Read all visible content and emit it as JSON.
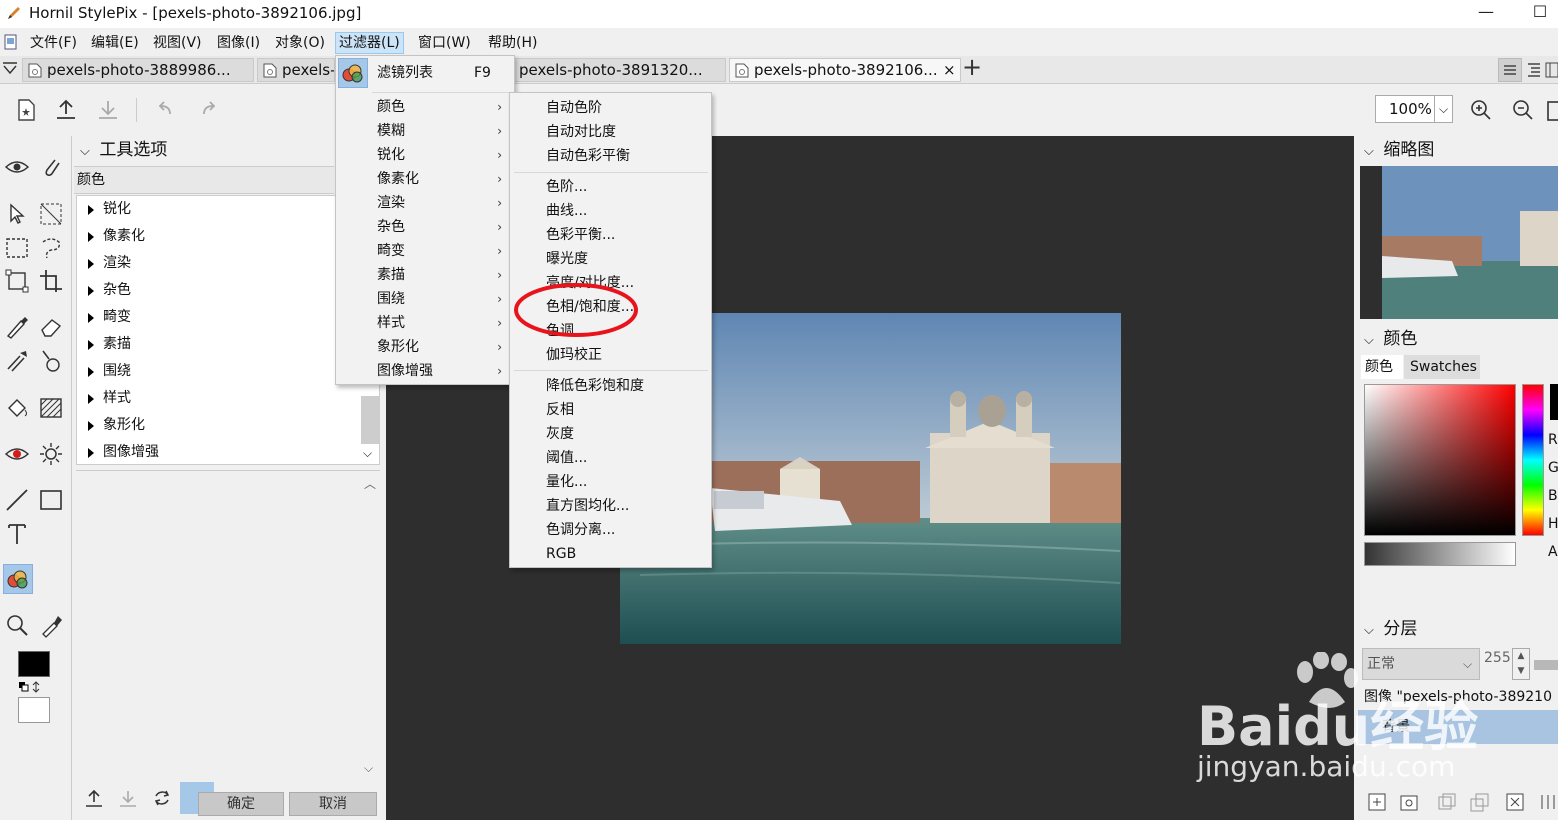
{
  "window": {
    "title": "Hornil StylePix - [pexels-photo-3892106.jpg]",
    "minimize": "—",
    "maximize": "☐"
  },
  "menubar": [
    {
      "label": "文件(F)"
    },
    {
      "label": "编辑(E)"
    },
    {
      "label": "视图(V)"
    },
    {
      "label": "图像(I)"
    },
    {
      "label": "对象(O)"
    },
    {
      "label": "过滤器(L)"
    },
    {
      "label": "窗口(W)"
    },
    {
      "label": "帮助(H)"
    }
  ],
  "tabs": [
    {
      "label": "pexels-photo-3889986..."
    },
    {
      "label": "pexels-"
    },
    {
      "label": "pexels-photo-3891320..."
    },
    {
      "label": "pexels-photo-3892106..."
    }
  ],
  "tab_close": "×",
  "tab_add": "+",
  "toolbar": {
    "zoom": "100%"
  },
  "tool_options": {
    "header": "工具选项",
    "selected": "颜色",
    "items": [
      "锐化",
      "像素化",
      "渲染",
      "杂色",
      "畸变",
      "素描",
      "围绕",
      "样式",
      "象形化",
      "图像增强"
    ],
    "ok_label": "确定",
    "cancel_label": "取消"
  },
  "filter_menu": {
    "top": {
      "label": "滤镜列表",
      "shortcut": "F9"
    },
    "items": [
      "颜色",
      "模糊",
      "锐化",
      "像素化",
      "渲染",
      "杂色",
      "畸变",
      "素描",
      "围绕",
      "样式",
      "象形化",
      "图像增强"
    ]
  },
  "color_submenu": {
    "group1": [
      "自动色阶",
      "自动对比度",
      "自动色彩平衡"
    ],
    "group2": [
      "色阶...",
      "曲线...",
      "色彩平衡...",
      "曝光度",
      "亮度/对比度...",
      "色相/饱和度...",
      "色调",
      "伽玛校正"
    ],
    "group3": [
      "降低色彩饱和度",
      "反相",
      "灰度",
      "阈值...",
      "量化...",
      "直方图均化...",
      "色调分离...",
      "RGB"
    ]
  },
  "right": {
    "thumbnail_header": "缩略图",
    "color_header": "颜色",
    "color_tabs": [
      "颜色",
      "Swatches"
    ],
    "channel_labels": [
      "R",
      "G",
      "B",
      "H",
      "A"
    ],
    "layers_header": "分层",
    "blend_mode": "正常",
    "opacity": "255",
    "layer_name": "图像 \"pexels-photo-389210",
    "layer_bg": "背景"
  },
  "watermark": {
    "brand": "Baidu经验",
    "url": "jingyan.baidu.com"
  },
  "colors": {
    "highlight_ring": "#e8141c",
    "selection": "#cce4f7",
    "canvas_bg": "#2e2e2e",
    "layer_selected": "#a8c4e0"
  }
}
